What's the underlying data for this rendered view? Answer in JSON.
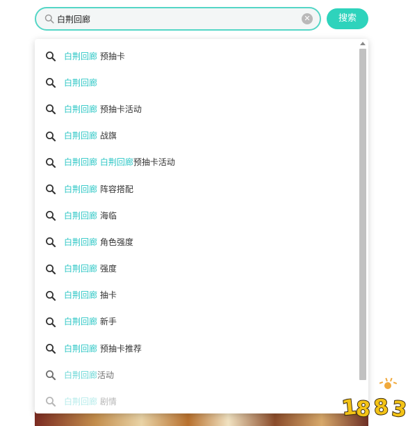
{
  "search": {
    "value": "白荆回廊",
    "button_label": "搜索"
  },
  "suggestions": [
    {
      "keyword": "白荆回廊",
      "rest": " 预抽卡"
    },
    {
      "keyword": "白荆回廊",
      "rest": ""
    },
    {
      "keyword": "白荆回廊",
      "rest": " 预抽卡活动"
    },
    {
      "keyword": "白荆回廊",
      "rest": " 战旗"
    },
    {
      "keyword": "白荆回廊",
      "rest": " ",
      "keyword2": "白荆回廊",
      "rest2": "预抽卡活动"
    },
    {
      "keyword": "白荆回廊",
      "rest": " 阵容搭配"
    },
    {
      "keyword": "白荆回廊",
      "rest": " 海临"
    },
    {
      "keyword": "白荆回廊",
      "rest": " 角色强度"
    },
    {
      "keyword": "白荆回廊",
      "rest": " 强度"
    },
    {
      "keyword": "白荆回廊",
      "rest": " 抽卡"
    },
    {
      "keyword": "白荆回廊",
      "rest": " 新手"
    },
    {
      "keyword": "白荆回廊",
      "rest": " 预抽卡推荐"
    },
    {
      "keyword": "白荆回廊",
      "rest": "活动"
    },
    {
      "keyword": "白荆回廊",
      "rest": " 剧情"
    }
  ],
  "watermark": {
    "text": "1883"
  },
  "icons": {
    "search": "search-icon",
    "suggestion": "magnifier-icon",
    "clear": "clear-icon"
  },
  "colors": {
    "accent": "#2ed3bc",
    "keyword": "#2ec7c6",
    "input_border": "#54d6c6"
  }
}
